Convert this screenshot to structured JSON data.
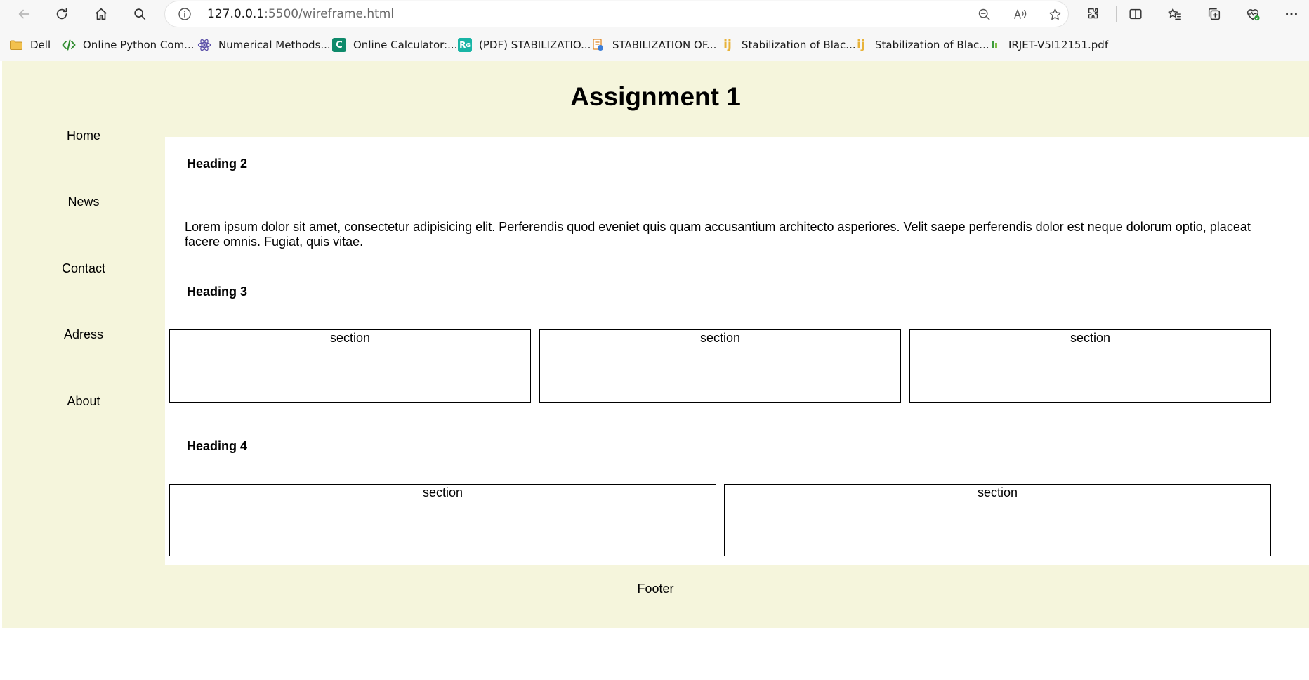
{
  "browser": {
    "url_host": "127.0.0.1",
    "url_rest": ":5500/wireframe.html",
    "bookmarks": [
      {
        "label": "Dell",
        "icon": "folder-icon",
        "color": "#e8b33a"
      },
      {
        "label": "Online Python Com...",
        "icon": "code-icon",
        "color": "#2e8b2e"
      },
      {
        "label": "Numerical Methods...",
        "icon": "atom-icon",
        "color": "#5a4fa8"
      },
      {
        "label": "Online Calculator:...",
        "icon": "calculator-icon",
        "color": "#0f8a6b"
      },
      {
        "label": "(PDF) STABILIZATIO...",
        "icon": "researchgate-icon",
        "color": "#19b5a6"
      },
      {
        "label": "STABILIZATION OF...",
        "icon": "document-icon",
        "color": "#e08a2a"
      },
      {
        "label": "Stabilization of Blac...",
        "icon": "ij-icon",
        "color": "#e8b33a"
      },
      {
        "label": "Stabilization of Blac...",
        "icon": "ij-icon",
        "color": "#e8b33a"
      },
      {
        "label": "IRJET-V5I12151.pdf",
        "icon": "pdf-icon",
        "color": "#3d9a3d"
      }
    ]
  },
  "page": {
    "title": "Assignment 1",
    "nav": [
      "Home",
      "News",
      "Contact",
      "Adress",
      "About"
    ],
    "heading2": "Heading 2",
    "paragraph": "Lorem ipsum dolor sit amet, consectetur adipisicing elit. Perferendis quod eveniet quis quam accusantium architecto asperiores. Velit saepe perferendis dolor est neque dolorum optio, placeat facere omnis. Fugiat, quis vitae.",
    "heading3": "Heading 3",
    "row1_sections": [
      "section",
      "section",
      "section"
    ],
    "heading4": "Heading 4",
    "row2_sections": [
      "section",
      "section"
    ],
    "footer": "Footer",
    "background_color": "#f5f5dc"
  }
}
